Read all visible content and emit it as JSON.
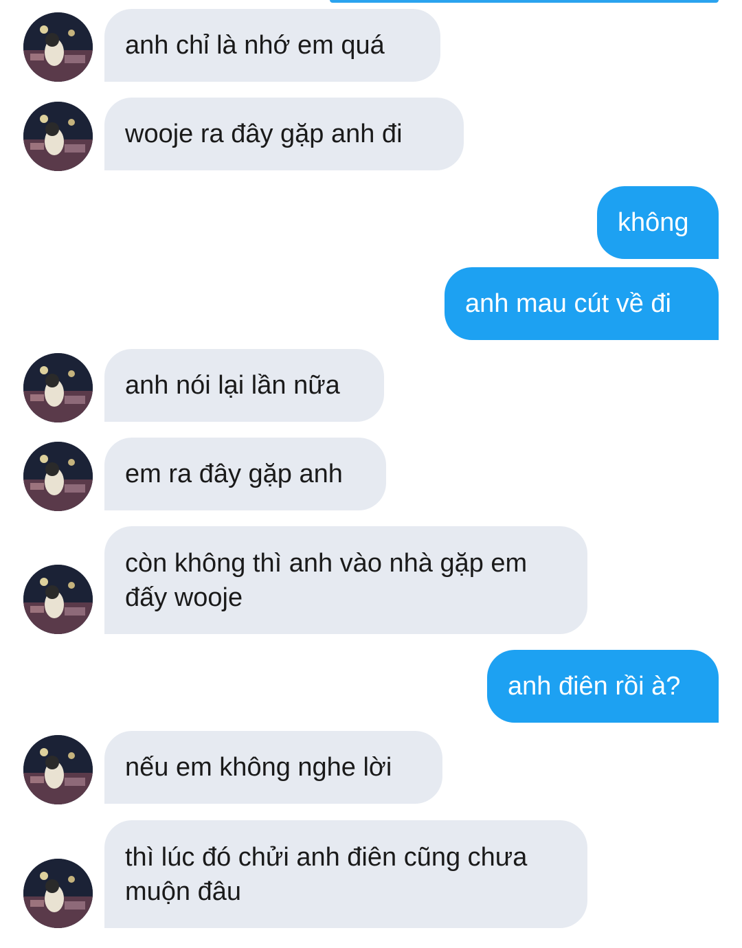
{
  "conversation": {
    "messages": [
      {
        "side": "received",
        "text": "anh chỉ là nhớ em quá"
      },
      {
        "side": "received",
        "text": "wooje ra đây gặp anh đi"
      },
      {
        "side": "sent",
        "text": "không"
      },
      {
        "side": "sent",
        "text": "anh mau cút về đi"
      },
      {
        "side": "received",
        "text": "anh nói lại lần nữa"
      },
      {
        "side": "received",
        "text": "em ra đây gặp anh"
      },
      {
        "side": "received",
        "text": "còn không thì anh vào nhà gặp em đấy wooje"
      },
      {
        "side": "sent",
        "text": "anh điên rồi à?"
      },
      {
        "side": "received",
        "text": "nếu em không nghe lời"
      },
      {
        "side": "received",
        "text": "thì lúc đó chửi anh điên cũng chưa muộn đâu"
      }
    ]
  },
  "colors": {
    "sent_bubble": "#1da1f2",
    "received_bubble": "#e6eaf1",
    "received_text": "#1a1a1a",
    "sent_text": "#ffffff"
  }
}
